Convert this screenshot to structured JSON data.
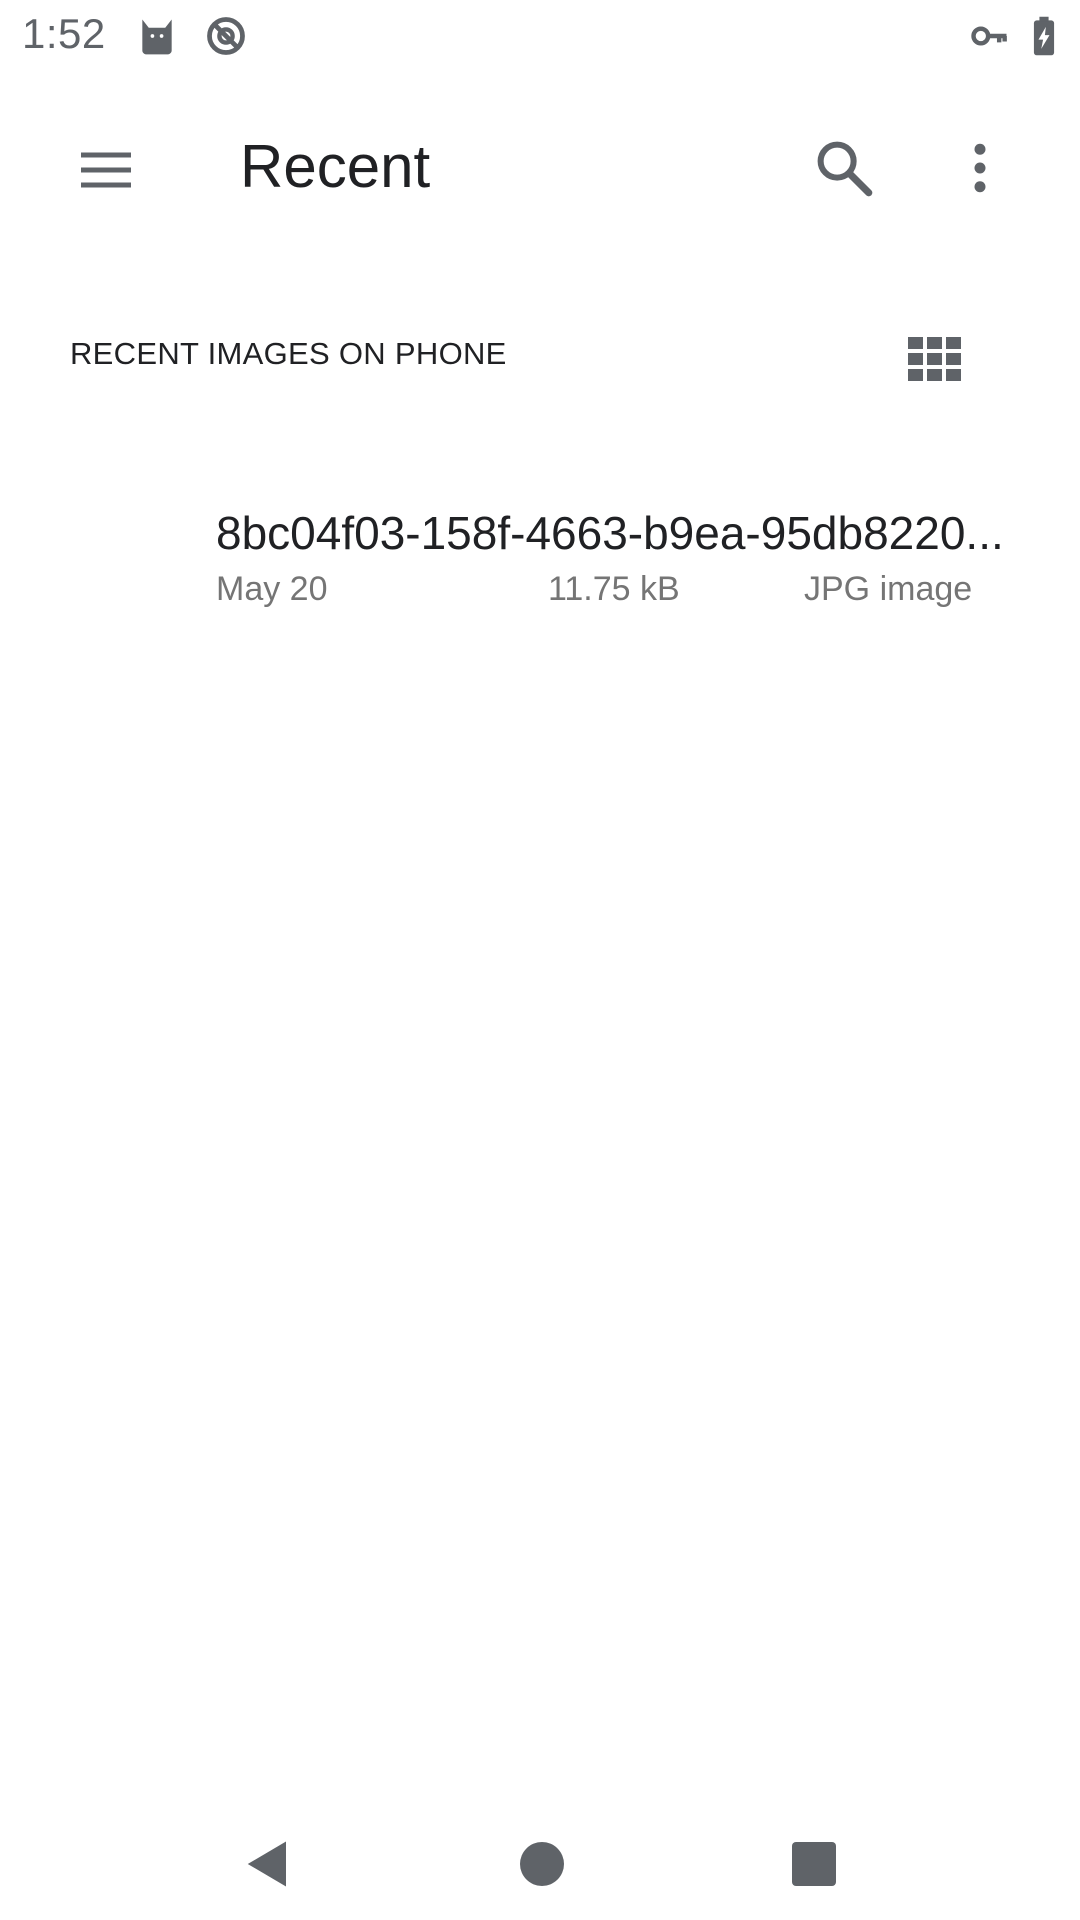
{
  "status_bar": {
    "time": "1:52",
    "icons": [
      "cat-icon",
      "no-sync-icon",
      "vpn-key-icon",
      "battery-charging-icon"
    ]
  },
  "app_bar": {
    "title": "Recent",
    "icons": [
      "menu-icon",
      "search-icon",
      "more-vert-icon"
    ]
  },
  "section": {
    "title": "RECENT IMAGES ON PHONE",
    "view_toggle_icon": "grid-view-icon"
  },
  "files": [
    {
      "name": "8bc04f03-158f-4663-b9ea-95db8220...",
      "date": "May 20",
      "size": "11.75 kB",
      "type": "JPG image"
    }
  ],
  "nav_bar": {
    "icons": [
      "back-icon",
      "home-icon",
      "recents-icon"
    ]
  },
  "colors": {
    "icon_gray": "#5f6368",
    "text_primary": "#202124",
    "text_secondary": "#757575"
  }
}
